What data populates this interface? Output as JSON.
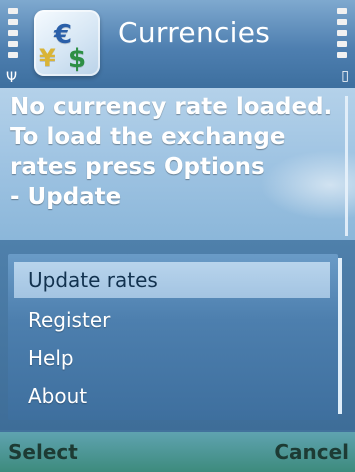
{
  "app": {
    "title": "Currencies"
  },
  "message": {
    "lines": [
      "No currency rate loaded.",
      "To load the exchange",
      "rates press Options",
      "- Update"
    ]
  },
  "menu": {
    "items": [
      {
        "label": "Update rates",
        "selected": true
      },
      {
        "label": "Register",
        "selected": false
      },
      {
        "label": "Help",
        "selected": false
      },
      {
        "label": "About",
        "selected": false
      }
    ]
  },
  "softkeys": {
    "left": "Select",
    "right": "Cancel"
  },
  "icons": {
    "app": "currency-exchange-icon",
    "signal": "signal-strength-icon",
    "battery": "battery-level-icon"
  },
  "colors": {
    "titlebar": "#4e7fb0",
    "menu_highlight": "#b8d4ec",
    "softkey_bar": "#3d8b7d"
  }
}
